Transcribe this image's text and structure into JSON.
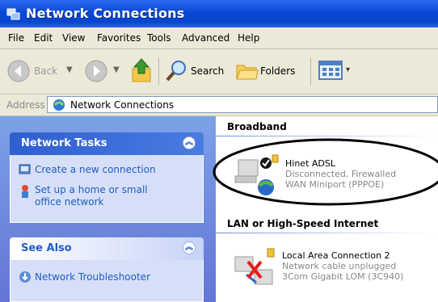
{
  "window": {
    "title": "Network Connections"
  },
  "menu": [
    "File",
    "Edit",
    "View",
    "Favorites",
    "Tools",
    "Advanced",
    "Help"
  ],
  "toolbar": {
    "back": "Back",
    "search": "Search",
    "folders": "Folders"
  },
  "address": {
    "label": "Address",
    "value": "Network Connections"
  },
  "tasks_panel": {
    "title": "Network Tasks",
    "items": [
      {
        "line1": "Create a new connection",
        "line2": "",
        "icon": "new-connection-icon"
      },
      {
        "line1": "Set up a home or small",
        "line2": "office network",
        "icon": "home-network-icon"
      }
    ]
  },
  "see_also_panel": {
    "title": "See Also",
    "items": [
      {
        "line1": "Network Troubleshooter",
        "icon": "troubleshooter-icon"
      }
    ]
  },
  "groups": [
    {
      "header": "Broadband",
      "connections": [
        {
          "name": "Hinet ADSL",
          "status": "Disconnected, Firewalled",
          "device": "WAN Miniport (PPPOE)",
          "icon": "broadband-connection-icon"
        }
      ]
    },
    {
      "header": "LAN or High-Speed Internet",
      "connections": [
        {
          "name": "Local Area Connection 2",
          "status": "Network cable unplugged",
          "device": "3Com Gigabit LOM (3C940)",
          "icon": "lan-connection-icon"
        }
      ]
    }
  ],
  "colors": {
    "titlebar": "#0a48d6",
    "taskpane": "#6f8fe0",
    "link": "#215dc6",
    "menubar": "#ece9d8"
  }
}
